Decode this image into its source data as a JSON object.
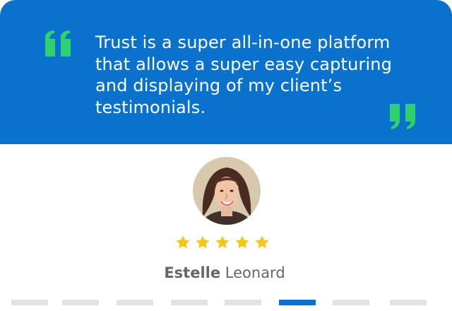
{
  "testimonial": {
    "quote": "Trust is a super all-in-one platform that allows a super easy capturing and displaying of my client’s testimonials.",
    "rating": 5,
    "author_first_name": "Estelle",
    "author_last_name": "Leonard"
  },
  "pager": {
    "count": 8,
    "active_index": 5
  },
  "colors": {
    "brand_blue": "#0a72cc",
    "quote_mark_green": "#2fd06e",
    "star_yellow": "#f5c518",
    "text_gray": "#666666",
    "pager_inactive": "#e2e2e2"
  },
  "icons": {
    "open_quote": "opening-quote-icon",
    "close_quote": "closing-quote-icon",
    "star": "star-icon"
  }
}
